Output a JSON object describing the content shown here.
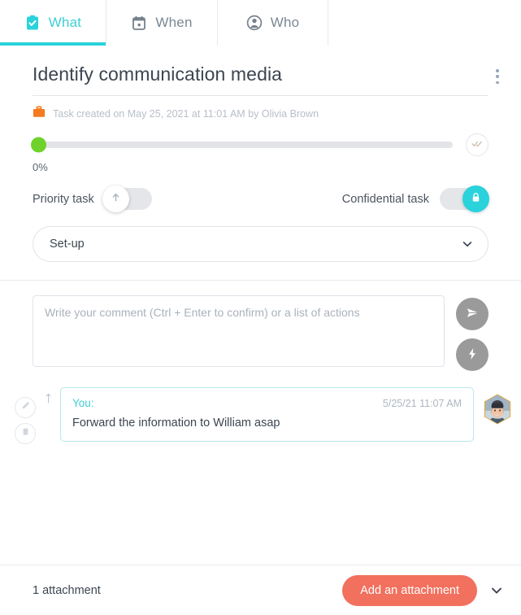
{
  "tabs": [
    {
      "label": "What",
      "icon": "clipboard-check-icon",
      "active": true
    },
    {
      "label": "When",
      "icon": "calendar-icon",
      "active": false
    },
    {
      "label": "Who",
      "icon": "person-icon",
      "active": false
    }
  ],
  "task": {
    "title": "Identify communication media",
    "meta": "Task created on May 25, 2021 at 11:01 AM by Olivia Brown",
    "meta_icon": "briefcase-icon",
    "menu_icon": "kebab-menu-icon"
  },
  "progress": {
    "percent_label": "0%",
    "value": 0,
    "complete_icon": "double-check-icon"
  },
  "toggles": {
    "priority": {
      "label": "Priority task",
      "state": "off",
      "icon": "arrow-up-icon"
    },
    "confidential": {
      "label": "Confidential task",
      "state": "on",
      "icon": "lock-icon"
    }
  },
  "category": {
    "value": "Set-up",
    "chevron_icon": "chevron-down-icon"
  },
  "composer": {
    "placeholder": "Write your comment (Ctrl + Enter to confirm) or a list of actions",
    "value": "",
    "send_icon": "send-paper-plane-icon",
    "quick_icon": "lightning-bolt-icon"
  },
  "comment": {
    "author": "You:",
    "timestamp": "5/25/21 11:07 AM",
    "text": "Forward the information to William asap",
    "edit_icon": "pencil-icon",
    "delete_icon": "trash-icon",
    "thread_icon": "arrow-up-icon",
    "avatar_name": "user-avatar"
  },
  "footer": {
    "attachment_count": "1 attachment",
    "add_button": "Add an attachment",
    "chevron_icon": "chevron-down-icon"
  },
  "colors": {
    "accent_teal": "#2ad2db",
    "progress_green": "#6ed22a",
    "attach_coral": "#f2705e",
    "meta_orange": "#f47b20"
  }
}
